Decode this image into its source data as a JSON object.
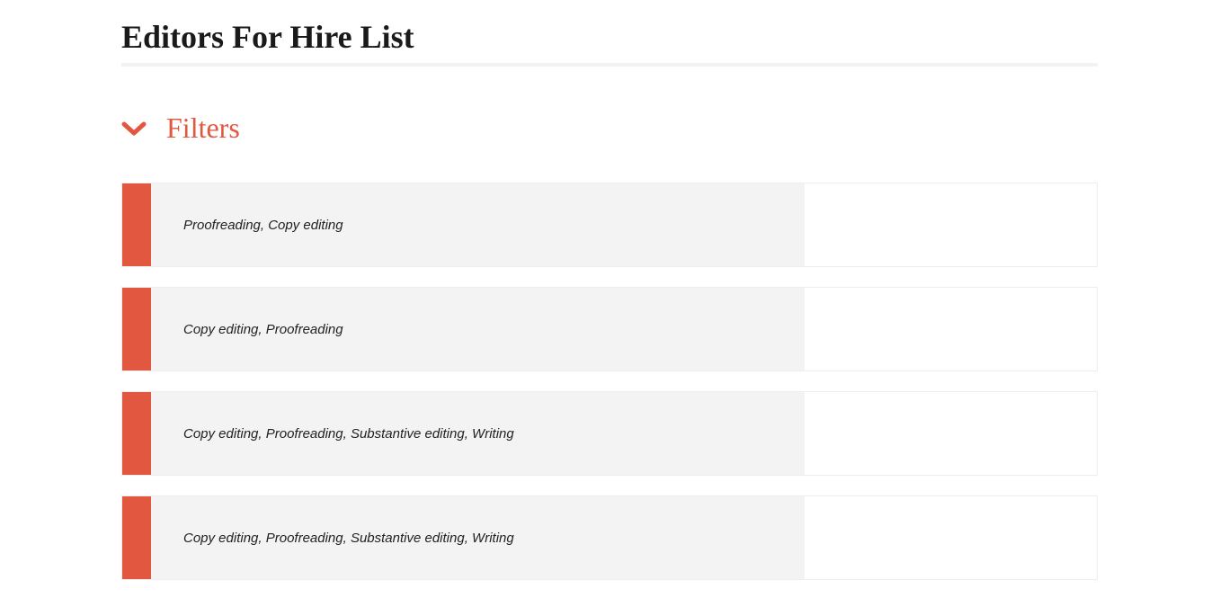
{
  "header": {
    "title": "Editors For Hire List"
  },
  "filters": {
    "label": "Filters"
  },
  "items": [
    {
      "text": "Proofreading, Copy editing"
    },
    {
      "text": "Copy editing, Proofreading"
    },
    {
      "text": "Copy editing, Proofreading, Substantive editing, Writing"
    },
    {
      "text": "Copy editing, Proofreading, Substantive editing, Writing"
    }
  ]
}
